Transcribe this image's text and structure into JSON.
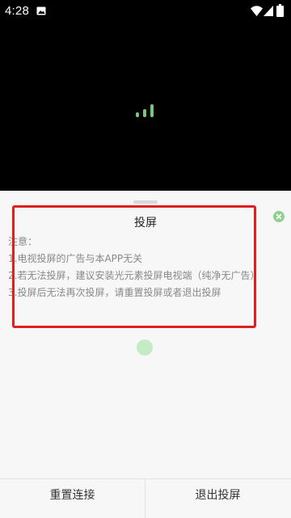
{
  "status_bar": {
    "time": "4:28",
    "icons": [
      "photo-icon",
      "wifi-icon",
      "signal-icon",
      "battery-icon"
    ]
  },
  "video": {
    "loading_icon": "loading-bars-icon"
  },
  "dialog": {
    "title": "投屏",
    "note_title": "注意：",
    "notes": [
      "1.电视投屏的广告与本APP无关",
      "2.若无法投屏，建议安装光元素投屏电视端（纯净无广告）",
      "3.投屏后无法再次投屏，请重置投屏或者退出投屏"
    ],
    "close_icon": "close-icon"
  },
  "actions": {
    "reconnect": "重置连接",
    "exit": "退出投屏"
  },
  "colors": {
    "accent_green": "#7cc47c",
    "highlight_red": "#e02020",
    "sheet_bg": "#f7f7f7"
  }
}
